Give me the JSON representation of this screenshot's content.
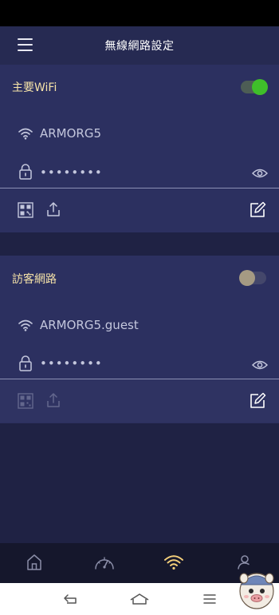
{
  "header": {
    "title": "無線網路設定"
  },
  "networks": [
    {
      "title": "主要WiFi",
      "enabled": true,
      "ssid": "ARMORG5",
      "password_masked": "••••••••",
      "actions_enabled": true
    },
    {
      "title": "訪客網路",
      "enabled": false,
      "ssid": "ARMORG5.guest",
      "password_masked": "••••••••",
      "actions_enabled": false
    }
  ],
  "bottom_nav": {
    "items": [
      "home-icon",
      "speedometer-icon",
      "wifi-icon",
      "user-settings-icon"
    ],
    "active_index": 2
  },
  "colors": {
    "accent": "#3fbf2a",
    "title_text": "#f5e2a8",
    "active_nav": "#f4cf7a"
  }
}
